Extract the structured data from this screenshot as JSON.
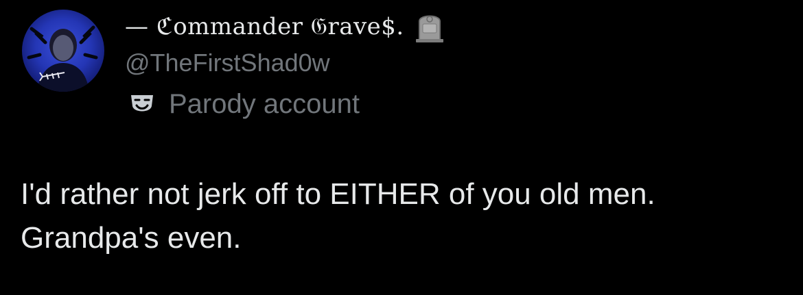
{
  "author": {
    "display_name": "— ℭommander 𝔊rave$.",
    "name_emoji": "headstone",
    "handle": "@TheFirstShad0w",
    "label_icon": "performing-arts-mask-icon",
    "label": "Parody account"
  },
  "tweet": {
    "lines": [
      "I'd rather not jerk off to EITHER of you old men.",
      "Grandpa's even."
    ]
  },
  "colors": {
    "background": "#000000",
    "primary_text": "#e7e9ea",
    "secondary_text": "#71767b",
    "avatar_accent": "#2a3ccf"
  }
}
